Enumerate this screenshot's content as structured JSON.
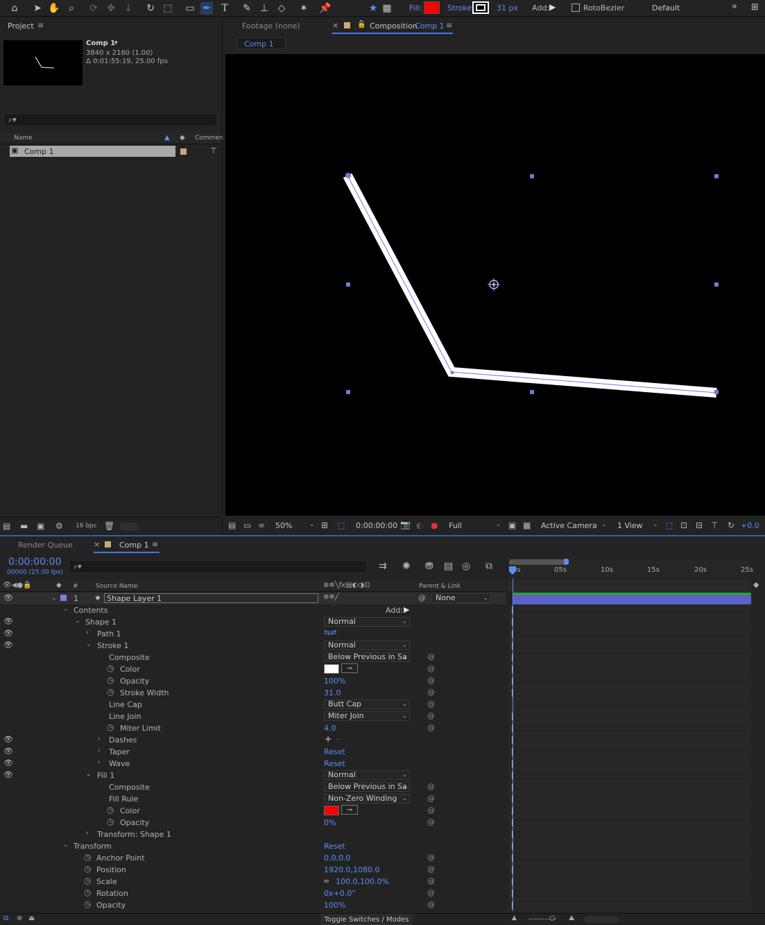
{
  "toolbar": {
    "fill_label": "Fill:",
    "stroke_label": "Stroke:",
    "stroke_width": "31 px",
    "add_label": "Add:",
    "rotobezier_label": "RotoBezier",
    "workspace": "Default",
    "fill_color": "#ff0000",
    "stroke_color": "#ffffff"
  },
  "project": {
    "title": "Project",
    "comp_name": "Comp 1",
    "comp_info_size": "3840 x 2160 (1.00)",
    "comp_info_duration": "Δ 0:01:55:19, 25.00 fps",
    "col_name": "Name",
    "col_comment": "Commen",
    "item_name": "Comp 1",
    "bpc": "16 bpc"
  },
  "viewer": {
    "tab_footage": "Footage (none)",
    "tab_comp_prefix": "Composition",
    "tab_comp_name": "Comp 1",
    "breadcrumb": "Comp 1",
    "zoom": "50%",
    "timecode": "0:00:00:00",
    "resolution": "Full",
    "camera": "Active Camera",
    "views": "1 View",
    "exposure": "+0.0"
  },
  "timeline": {
    "tab_render_queue": "Render Queue",
    "tab_comp": "Comp 1",
    "timecode": "0:00:00:00",
    "frame_info": "00000 (25.00 fps)",
    "col_num": "#",
    "col_source": "Source Name",
    "col_parent": "Parent & Link",
    "layer_num": "1",
    "layer_name": "Shape Layer 1",
    "parent_value": "None",
    "ruler": [
      "0s",
      "05s",
      "10s",
      "15s",
      "20s",
      "25s"
    ],
    "toggle_label": "Toggle Switches / Modes",
    "add_label": "Add:"
  },
  "props": {
    "contents": "Contents",
    "shape1": "Shape 1",
    "shape1_mode": "Normal",
    "path1": "Path 1",
    "stroke1": "Stroke 1",
    "stroke1_mode": "Normal",
    "composite": "Composite",
    "composite_value": "Below Previous in Sa",
    "color": "Color",
    "opacity": "Opacity",
    "stroke_opacity": "100%",
    "stroke_width": "Stroke Width",
    "stroke_width_value": "31.0",
    "line_cap": "Line Cap",
    "line_cap_value": "Butt Cap",
    "line_join": "Line Join",
    "line_join_value": "Miter Join",
    "miter_limit": "Miter Limit",
    "miter_limit_value": "4.0",
    "dashes": "Dashes",
    "taper": "Taper",
    "wave": "Wave",
    "reset": "Reset",
    "fill1": "Fill 1",
    "fill1_mode": "Normal",
    "fill_composite_value": "Below Previous in Sa",
    "fill_rule": "Fill Rule",
    "fill_rule_value": "Non-Zero Winding",
    "fill_opacity": "0%",
    "transform_shape": "Transform: Shape 1",
    "transform": "Transform",
    "anchor_point": "Anchor Point",
    "anchor_value": "0.0,0.0",
    "position": "Position",
    "position_value": "1920.0,1080.0",
    "scale": "Scale",
    "scale_value": "100.0,100.0%",
    "rotation": "Rotation",
    "rotation_value": "0x+0.0°",
    "t_opacity": "Opacity",
    "t_opacity_value": "100%"
  }
}
